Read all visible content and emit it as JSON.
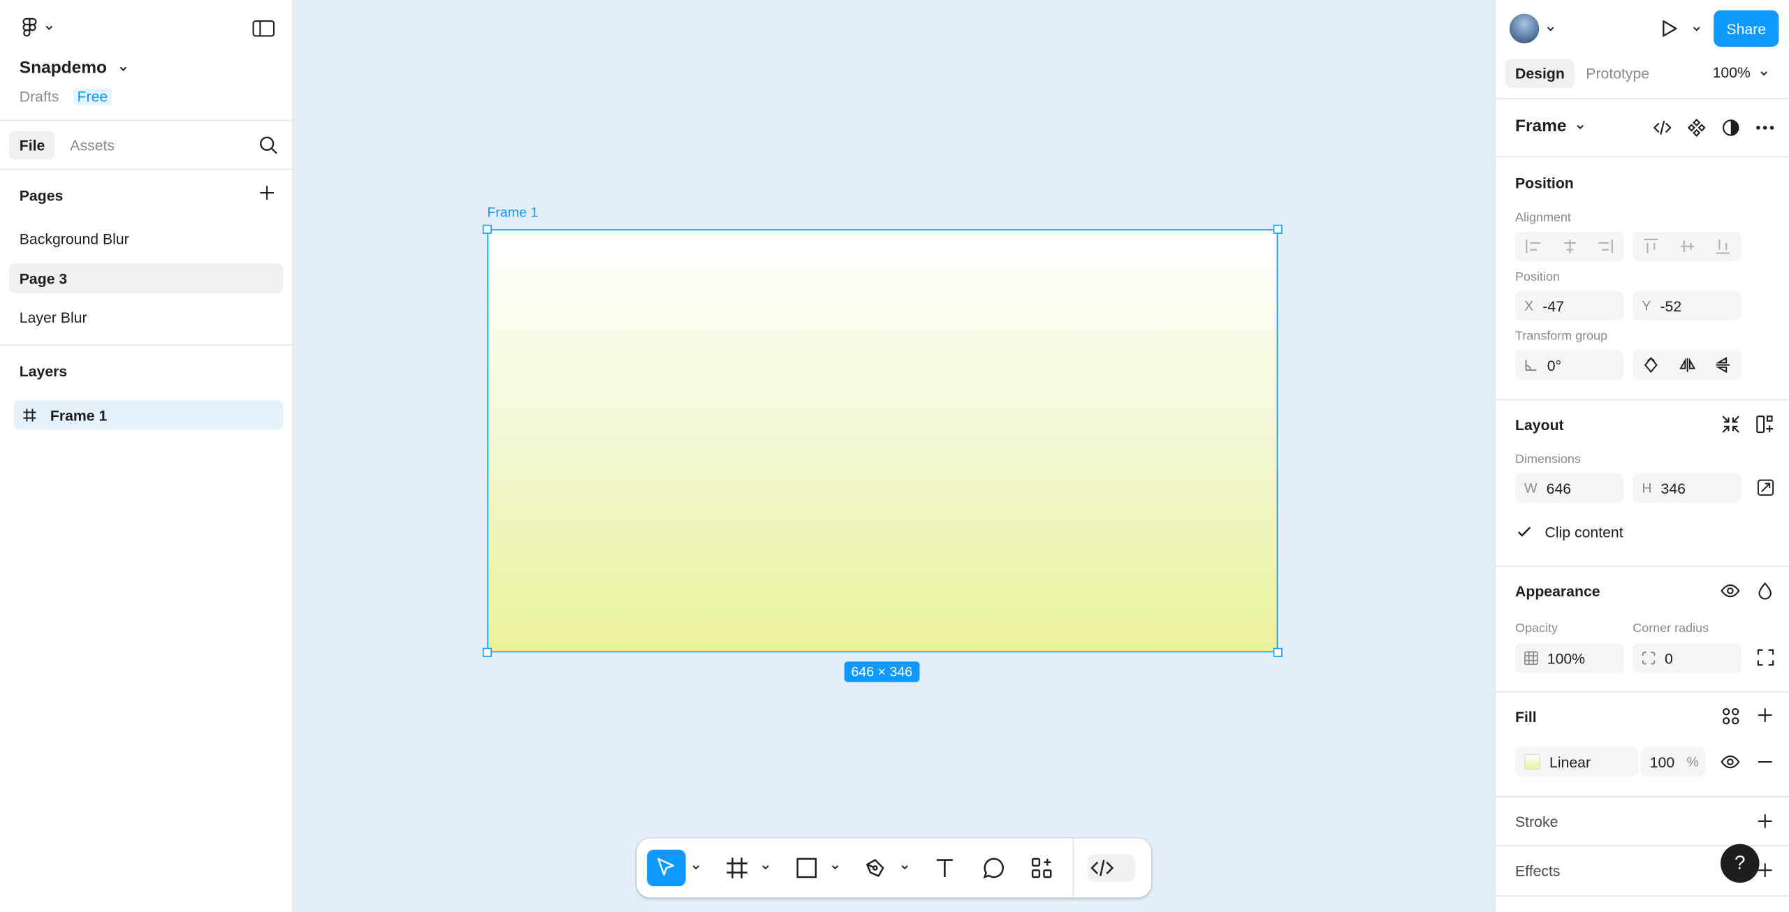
{
  "left_panel": {
    "project_name": "Snapdemo",
    "location": "Drafts",
    "plan": "Free",
    "tabs": [
      {
        "label": "File",
        "active": true
      },
      {
        "label": "Assets",
        "active": false
      }
    ],
    "pages_title": "Pages",
    "pages": [
      {
        "label": "Background Blur",
        "active": false
      },
      {
        "label": "Page 3",
        "active": true
      },
      {
        "label": "Layer Blur",
        "active": false
      }
    ],
    "layers_title": "Layers",
    "layers": [
      {
        "label": "Frame 1",
        "icon": "frame-hash-icon",
        "selected": true
      }
    ]
  },
  "canvas": {
    "frame_label": "Frame 1",
    "size_badge": "646 × 346",
    "frame_gradient": [
      "#ffffff",
      "#ebf29b"
    ],
    "background": "#e4eef9",
    "selection_color": "#0d99ff"
  },
  "toolbar": {
    "tools": [
      "move-icon",
      "frame-icon",
      "rectangle-icon",
      "pen-icon",
      "text-icon",
      "comment-icon",
      "actions-icon"
    ],
    "dev_mode_icon": "code-icon",
    "active_tool": "move"
  },
  "right_panel": {
    "share_label": "Share",
    "tabs": [
      {
        "label": "Design",
        "active": true
      },
      {
        "label": "Prototype",
        "active": false
      }
    ],
    "zoom": "100%",
    "selection_type": "Frame",
    "position": {
      "title": "Position",
      "alignment_label": "Alignment",
      "position_label": "Position",
      "x_prefix": "X",
      "x": "-47",
      "y_prefix": "Y",
      "y": "-52",
      "transform_label": "Transform group",
      "rotation": "0°"
    },
    "layout": {
      "title": "Layout",
      "dimensions_label": "Dimensions",
      "w_prefix": "W",
      "w": "646",
      "h_prefix": "H",
      "h": "346",
      "clip_label": "Clip content",
      "clip_checked": true
    },
    "appearance": {
      "title": "Appearance",
      "opacity_label": "Opacity",
      "opacity": "100%",
      "radius_label": "Corner radius",
      "radius": "0"
    },
    "fill": {
      "title": "Fill",
      "type": "Linear",
      "opacity": "100",
      "unit": "%"
    },
    "stroke_title": "Stroke",
    "effects_title": "Effects",
    "help_label": "?",
    "accent": "#0d99ff"
  }
}
